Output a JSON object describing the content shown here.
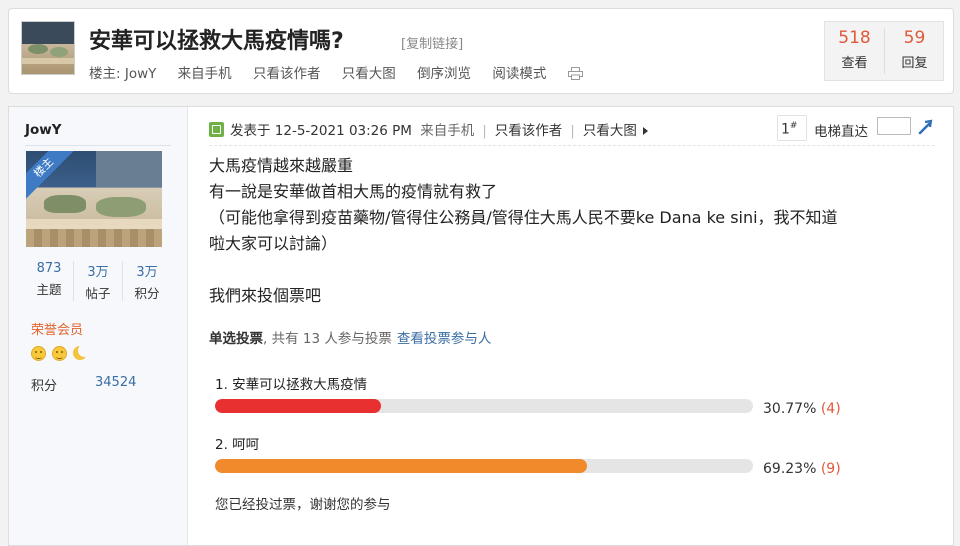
{
  "thread": {
    "title": "安華可以拯救大馬疫情嗎?",
    "copy_link": "[复制链接]",
    "author_label": "楼主: JowY",
    "actions": [
      "来自手机",
      "只看该作者",
      "只看大图",
      "倒序浏览",
      "阅读模式"
    ],
    "stats": {
      "views": "518",
      "views_label": "查看",
      "replies": "59",
      "replies_label": "回复"
    }
  },
  "user": {
    "name": "JowY",
    "badge": "楼主",
    "stats": [
      {
        "value": "873",
        "label": "主题"
      },
      {
        "value": "3万",
        "label": "帖子"
      },
      {
        "value": "3万",
        "label": "积分"
      }
    ],
    "rank": "荣誉会员",
    "points_label": "积分",
    "points_value": "34524"
  },
  "post": {
    "posted_at": "发表于 12-5-2021 03:26 PM",
    "source": "来自手机",
    "only_author": "只看该作者",
    "only_images": "只看大图",
    "floor": "1",
    "floor_sup": "#",
    "elevator_label": "电梯直达",
    "lines": [
      "大馬疫情越來越嚴重",
      "有一說是安華做首相大馬的疫情就有救了",
      "（可能他拿得到疫苗藥物/管得住公務員/管得住大馬人民不要ke Dana ke sini，我不知道",
      "啦大家可以討論）"
    ],
    "closing_line": "我們來投個票吧"
  },
  "poll": {
    "type_label": "单选投票",
    "summary": ", 共有 13 人参与投票",
    "view_voters": "查看投票参与人",
    "options": [
      {
        "label": "1.  安華可以拯救大馬疫情",
        "percent": 30.77,
        "percent_text": "30.77%",
        "count_text": "(4)",
        "color": "#e83030"
      },
      {
        "label": "2.  呵呵",
        "percent": 69.23,
        "percent_text": "69.23%",
        "count_text": "(9)",
        "color": "#f08a2a"
      }
    ],
    "voted_note": "您已经投过票，谢谢您的参与"
  }
}
